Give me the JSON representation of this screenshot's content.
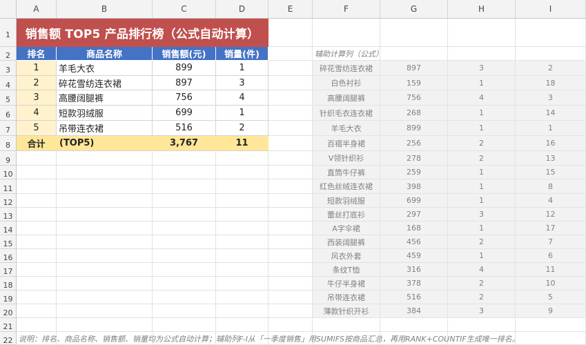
{
  "columns": [
    "A",
    "B",
    "C",
    "D",
    "E",
    "F",
    "G",
    "H",
    "I"
  ],
  "rows": [
    "1",
    "2",
    "3",
    "4",
    "5",
    "6",
    "7",
    "8",
    "9",
    "10",
    "11",
    "12",
    "13",
    "14",
    "15",
    "16",
    "17",
    "18",
    "19",
    "20",
    "21",
    "22"
  ],
  "title": "销售额 TOP5 产品排行榜（公式自动计算）",
  "headers": [
    "排名",
    "商品名称",
    "销售额(元)",
    "销量(件)"
  ],
  "top5": [
    {
      "rank": "1",
      "name": "羊毛大衣",
      "sales": "899",
      "qty": "1"
    },
    {
      "rank": "2",
      "name": "碎花雪纺连衣裙",
      "sales": "897",
      "qty": "3"
    },
    {
      "rank": "3",
      "name": "高腰阔腿裤",
      "sales": "756",
      "qty": "4"
    },
    {
      "rank": "4",
      "name": "短款羽绒服",
      "sales": "699",
      "qty": "1"
    },
    {
      "rank": "5",
      "name": "吊带连衣裙",
      "sales": "516",
      "qty": "2"
    }
  ],
  "total": {
    "label": "合计",
    "sub": "(TOP5)",
    "sales": "3,767",
    "qty": "11"
  },
  "helper_label": "辅助计算列（公式）",
  "helper": [
    {
      "name": "碎花雪纺连衣裙",
      "sales": "897",
      "qty": "3",
      "rank": "2"
    },
    {
      "name": "白色衬衫",
      "sales": "159",
      "qty": "1",
      "rank": "18"
    },
    {
      "name": "高腰阔腿裤",
      "sales": "756",
      "qty": "4",
      "rank": "3"
    },
    {
      "name": "针织毛衣连衣裙",
      "sales": "268",
      "qty": "1",
      "rank": "14"
    },
    {
      "name": "羊毛大衣",
      "sales": "899",
      "qty": "1",
      "rank": "1"
    },
    {
      "name": "百褶半身裙",
      "sales": "256",
      "qty": "2",
      "rank": "16"
    },
    {
      "name": "V领针织衫",
      "sales": "278",
      "qty": "2",
      "rank": "13"
    },
    {
      "name": "直筒牛仔裤",
      "sales": "259",
      "qty": "1",
      "rank": "15"
    },
    {
      "name": "红色丝绒连衣裙",
      "sales": "398",
      "qty": "1",
      "rank": "8"
    },
    {
      "name": "短款羽绒服",
      "sales": "699",
      "qty": "1",
      "rank": "4"
    },
    {
      "name": "蕾丝打底衫",
      "sales": "297",
      "qty": "3",
      "rank": "12"
    },
    {
      "name": "A字伞裙",
      "sales": "168",
      "qty": "1",
      "rank": "17"
    },
    {
      "name": "西装阔腿裤",
      "sales": "456",
      "qty": "2",
      "rank": "7"
    },
    {
      "name": "风衣外套",
      "sales": "459",
      "qty": "1",
      "rank": "6"
    },
    {
      "name": "条纹T恤",
      "sales": "316",
      "qty": "4",
      "rank": "11"
    },
    {
      "name": "牛仔半身裙",
      "sales": "378",
      "qty": "2",
      "rank": "10"
    },
    {
      "name": "吊带连衣裙",
      "sales": "516",
      "qty": "2",
      "rank": "5"
    },
    {
      "name": "薄款针织开衫",
      "sales": "384",
      "qty": "3",
      "rank": "9"
    }
  ],
  "note": "说明：排名、商品名称、销售额、销量均为公式自动计算；辅助列F-I从「一季度销售」用SUMIFS按商品汇总，再用RANK+COUNTIF生成唯一排名。",
  "colors": {
    "title_bg": "#c0504d",
    "header_bg": "#4472c4",
    "rank_bg": "#fff2cc",
    "total_bg": "#ffe699",
    "helper_bg": "#f2f2f2"
  }
}
